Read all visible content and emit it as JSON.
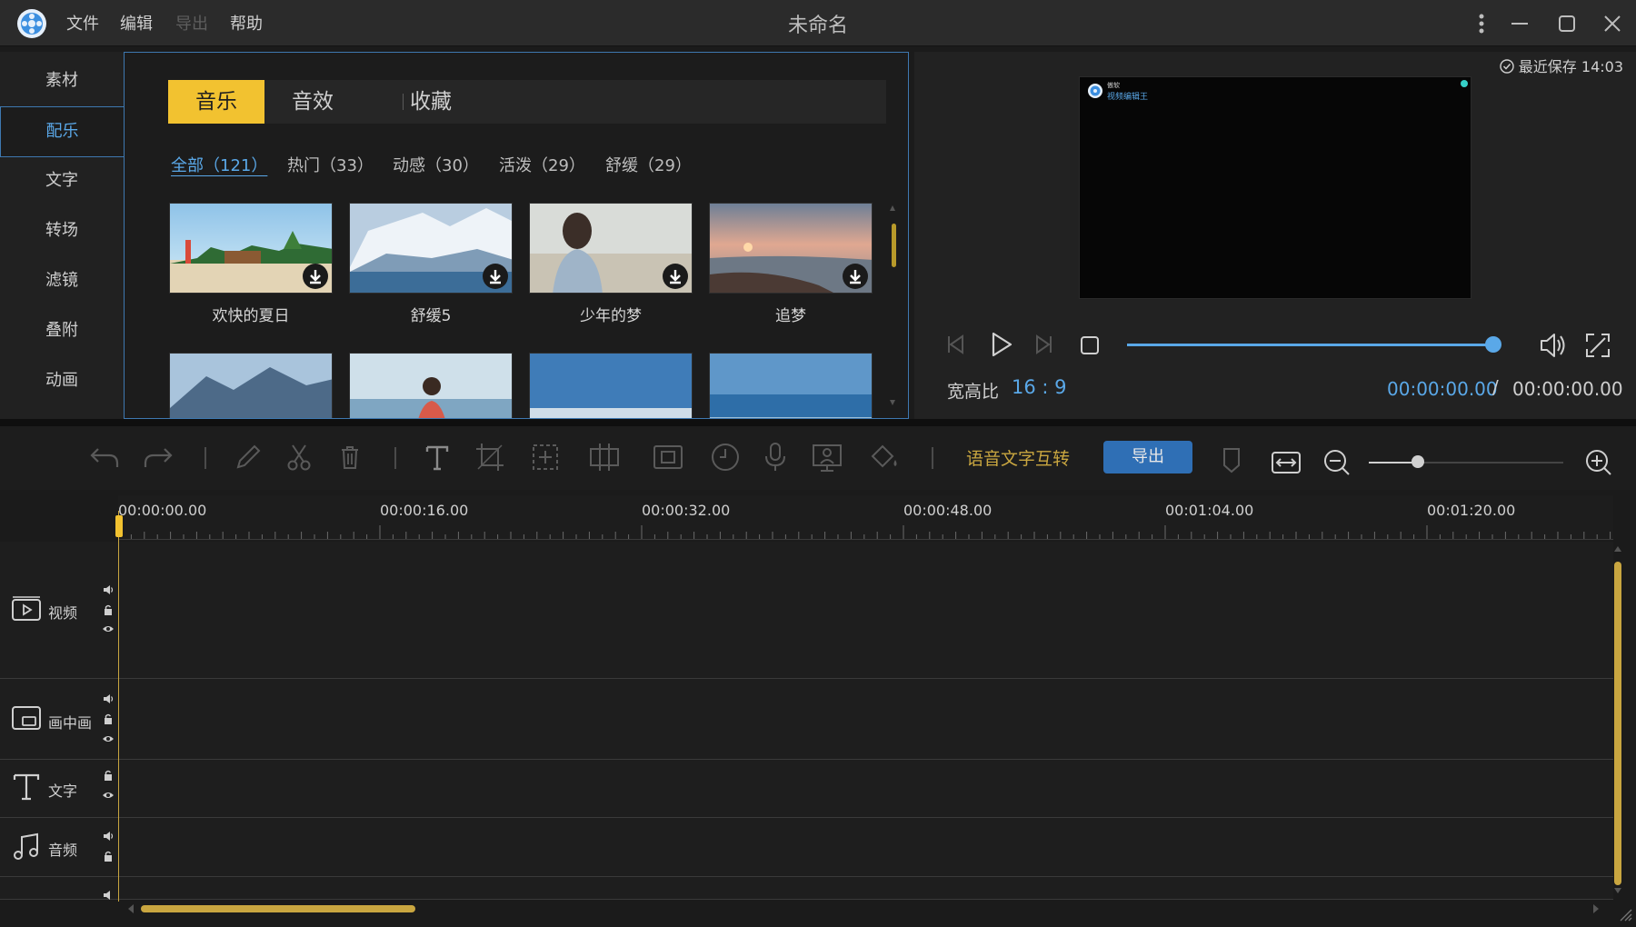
{
  "titlebar": {
    "title": "未命名",
    "menus": [
      {
        "label": "文件",
        "enabled": true
      },
      {
        "label": "编辑",
        "enabled": true
      },
      {
        "label": "导出",
        "enabled": false
      },
      {
        "label": "帮助",
        "enabled": true
      }
    ]
  },
  "leftnav": {
    "items": [
      "素材",
      "配乐",
      "文字",
      "转场",
      "滤镜",
      "叠附",
      "动画"
    ],
    "active": "配乐"
  },
  "library": {
    "tabs": [
      "音乐",
      "音效",
      "收藏"
    ],
    "active_tab": "音乐",
    "filters": [
      "全部（121）",
      "热门（33）",
      "动感（30）",
      "活泼（29）",
      "舒缓（29）"
    ],
    "active_filter": 0,
    "tracks": [
      {
        "title": "欢快的夏日"
      },
      {
        "title": "舒缓5"
      },
      {
        "title": "少年的梦"
      },
      {
        "title": "追梦"
      }
    ]
  },
  "preview": {
    "last_saved": "最近保存 14:03",
    "watermark_small": "傲软",
    "watermark_name": "视频编辑王",
    "aspect_label": "宽高比",
    "aspect_value": "16 : 9",
    "time_current": "00:00:00.00",
    "time_separator": "/",
    "time_total": "00:00:00.00",
    "volume_progress": 1.0
  },
  "toolbar": {
    "speech_to_text": "语音文字互转",
    "export": "导出",
    "zoom_level": 0.25
  },
  "ruler": {
    "ticks": [
      "00:00:00.00",
      "00:00:16.00",
      "00:00:32.00",
      "00:00:48.00",
      "00:01:04.00",
      "00:01:20.00"
    ]
  },
  "tracks": [
    {
      "label": "视频"
    },
    {
      "label": "画中画"
    },
    {
      "label": "文字"
    },
    {
      "label": "音频"
    }
  ],
  "colors": {
    "accent_blue": "#5aa8e8",
    "accent_yellow": "#f2c230",
    "export_button": "#2f6fb5"
  }
}
